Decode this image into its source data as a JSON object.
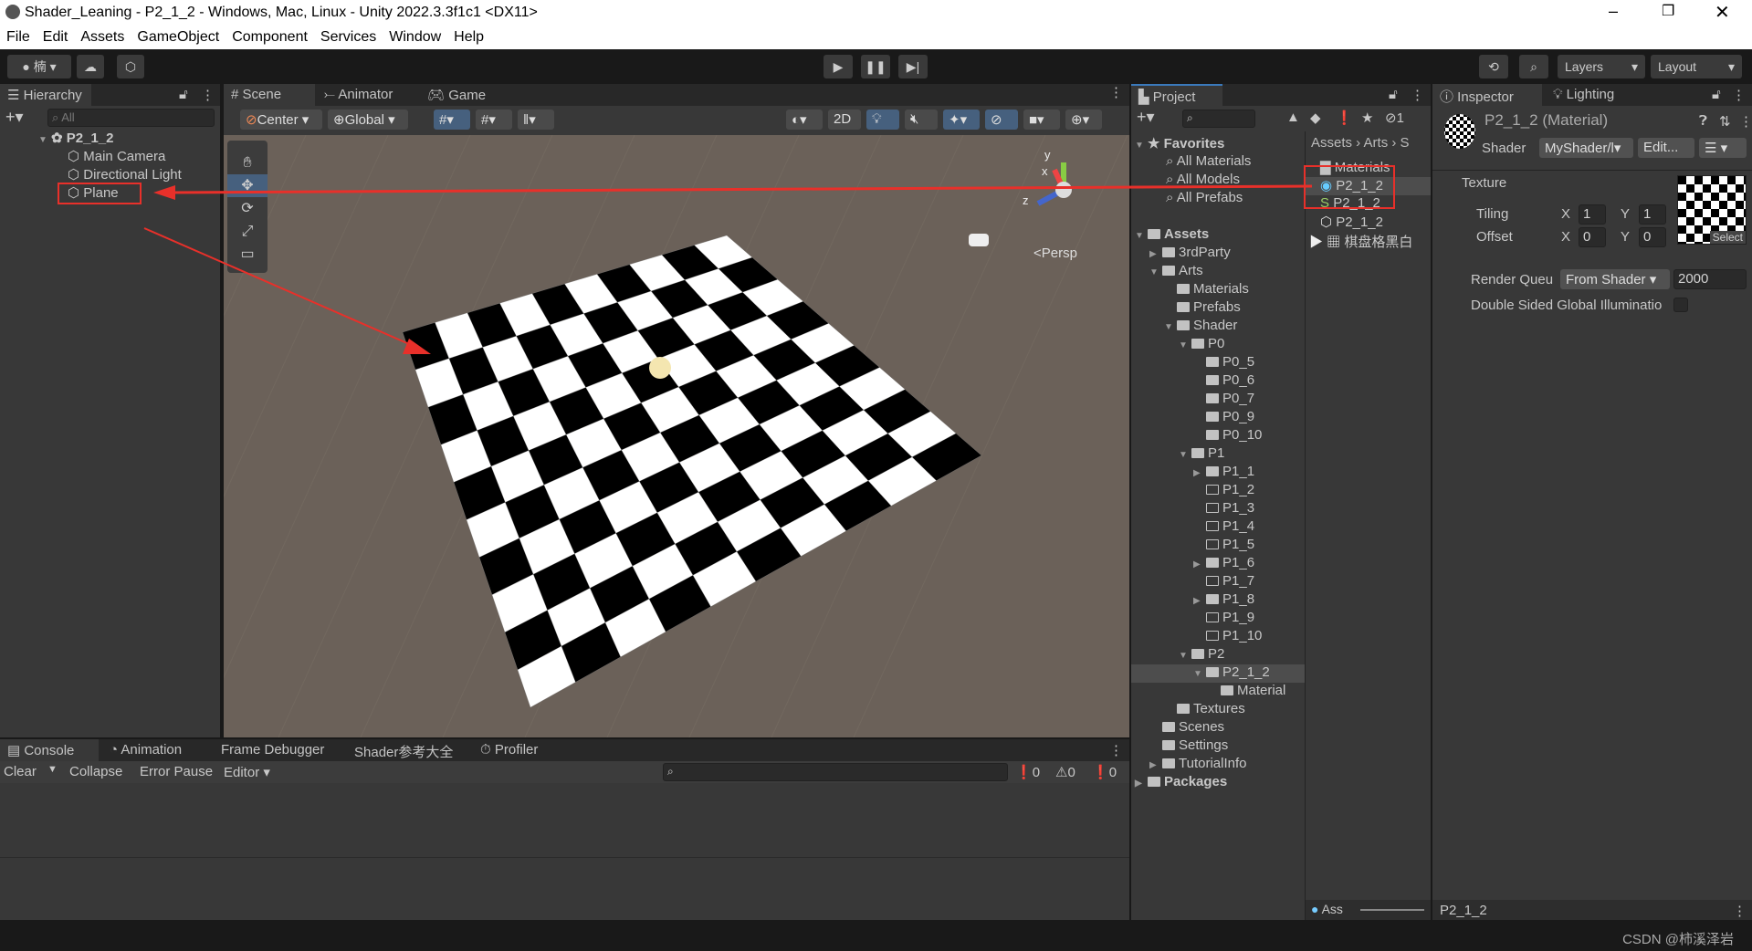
{
  "window": {
    "title": "Shader_Leaning - P2_1_2 - Windows, Mac, Linux - Unity 2022.3.3f1c1 <DX11>"
  },
  "menu": [
    "File",
    "Edit",
    "Assets",
    "GameObject",
    "Component",
    "Services",
    "Window",
    "Help"
  ],
  "toolbar": {
    "account": "楠",
    "layers": "Layers",
    "layout": "Layout"
  },
  "hierarchy": {
    "title": "Hierarchy",
    "search_placeholder": "All",
    "scene": "P2_1_2",
    "items": [
      "Main Camera",
      "Directional Light",
      "Plane"
    ]
  },
  "scene_tabs": [
    "Scene",
    "Animator",
    "Game"
  ],
  "scene_toolbar": {
    "pivot": "Center",
    "space": "Global",
    "mode_2d": "2D"
  },
  "scene_view": {
    "persp_label": "<Persp",
    "axes": {
      "x": "x",
      "y": "y",
      "z": "z"
    },
    "checker_cells": 10,
    "colors": {
      "background": "#6b6159",
      "white": "#ffffff",
      "black": "#000000",
      "annotation": "#e8302a"
    }
  },
  "project": {
    "title": "Project",
    "favorites": "Favorites",
    "favorite_items": [
      "All Materials",
      "All Models",
      "All Prefabs"
    ],
    "tree": [
      {
        "label": "Assets",
        "depth": 0,
        "bold": true,
        "open": true
      },
      {
        "label": "3rdParty",
        "depth": 1,
        "fold": "closed"
      },
      {
        "label": "Arts",
        "depth": 1,
        "open": true
      },
      {
        "label": "Materials",
        "depth": 2
      },
      {
        "label": "Prefabs",
        "depth": 2
      },
      {
        "label": "Shader",
        "depth": 2,
        "open": true
      },
      {
        "label": "P0",
        "depth": 3,
        "open": true
      },
      {
        "label": "P0_5",
        "depth": 4
      },
      {
        "label": "P0_6",
        "depth": 4
      },
      {
        "label": "P0_7",
        "depth": 4
      },
      {
        "label": "P0_9",
        "depth": 4
      },
      {
        "label": "P0_10",
        "depth": 4
      },
      {
        "label": "P1",
        "depth": 3,
        "open": true
      },
      {
        "label": "P1_1",
        "depth": 4,
        "fold": "closed"
      },
      {
        "label": "P1_2",
        "depth": 4,
        "empty": true
      },
      {
        "label": "P1_3",
        "depth": 4,
        "empty": true
      },
      {
        "label": "P1_4",
        "depth": 4,
        "empty": true
      },
      {
        "label": "P1_5",
        "depth": 4,
        "empty": true
      },
      {
        "label": "P1_6",
        "depth": 4,
        "fold": "closed"
      },
      {
        "label": "P1_7",
        "depth": 4,
        "empty": true
      },
      {
        "label": "P1_8",
        "depth": 4,
        "fold": "closed"
      },
      {
        "label": "P1_9",
        "depth": 4,
        "empty": true
      },
      {
        "label": "P1_10",
        "depth": 4,
        "empty": true
      },
      {
        "label": "P2",
        "depth": 3,
        "open": true
      },
      {
        "label": "P2_1_2",
        "depth": 4,
        "open": true,
        "selected": true
      },
      {
        "label": "Material",
        "depth": 5
      },
      {
        "label": "Textures",
        "depth": 2
      },
      {
        "label": "Scenes",
        "depth": 1
      },
      {
        "label": "Settings",
        "depth": 1
      },
      {
        "label": "TutorialInfo",
        "depth": 1,
        "fold": "closed"
      },
      {
        "label": "Packages",
        "depth": 0,
        "bold": true,
        "fold": "closed"
      }
    ],
    "breadcrumb": [
      "Assets",
      "Arts",
      "S"
    ],
    "files": [
      "Materials",
      "P2_1_2",
      "P2_1_2",
      "P2_1_2",
      "棋盘格黑白"
    ],
    "file_icons": [
      "folder-icon",
      "material-icon",
      "shader-icon",
      "prefab-icon",
      "texture-icon"
    ],
    "bottom": "Ass",
    "hidden_count": "1"
  },
  "inspector": {
    "title": "Inspector",
    "lighting_tab": "Lighting",
    "asset_name": "P2_1_2 (Material)",
    "shader_label": "Shader",
    "shader_value": "MyShader/l",
    "edit_button": "Edit...",
    "texture_label": "Texture",
    "tiling_label": "Tiling",
    "offset_label": "Offset",
    "x": "X",
    "y": "Y",
    "tiling_x": "1",
    "tiling_y": "1",
    "offset_x": "0",
    "offset_y": "0",
    "select": "Select",
    "render_queue_label": "Render Queu",
    "render_queue_mode": "From Shader",
    "render_queue_value": "2000",
    "double_sided_label": "Double Sided Global Illuminatio",
    "footer": "P2_1_2"
  },
  "console": {
    "tabs": [
      "Console",
      "Animation",
      "Frame Debugger",
      "Shader参考大全",
      "Profiler"
    ],
    "clear": "Clear",
    "collapse": "Collapse",
    "error_pause": "Error Pause",
    "editor": "Editor",
    "log_count": "0",
    "warn_count": "0",
    "error_count": "0"
  },
  "status": {
    "watermark": "CSDN @柿溪泽岩"
  }
}
